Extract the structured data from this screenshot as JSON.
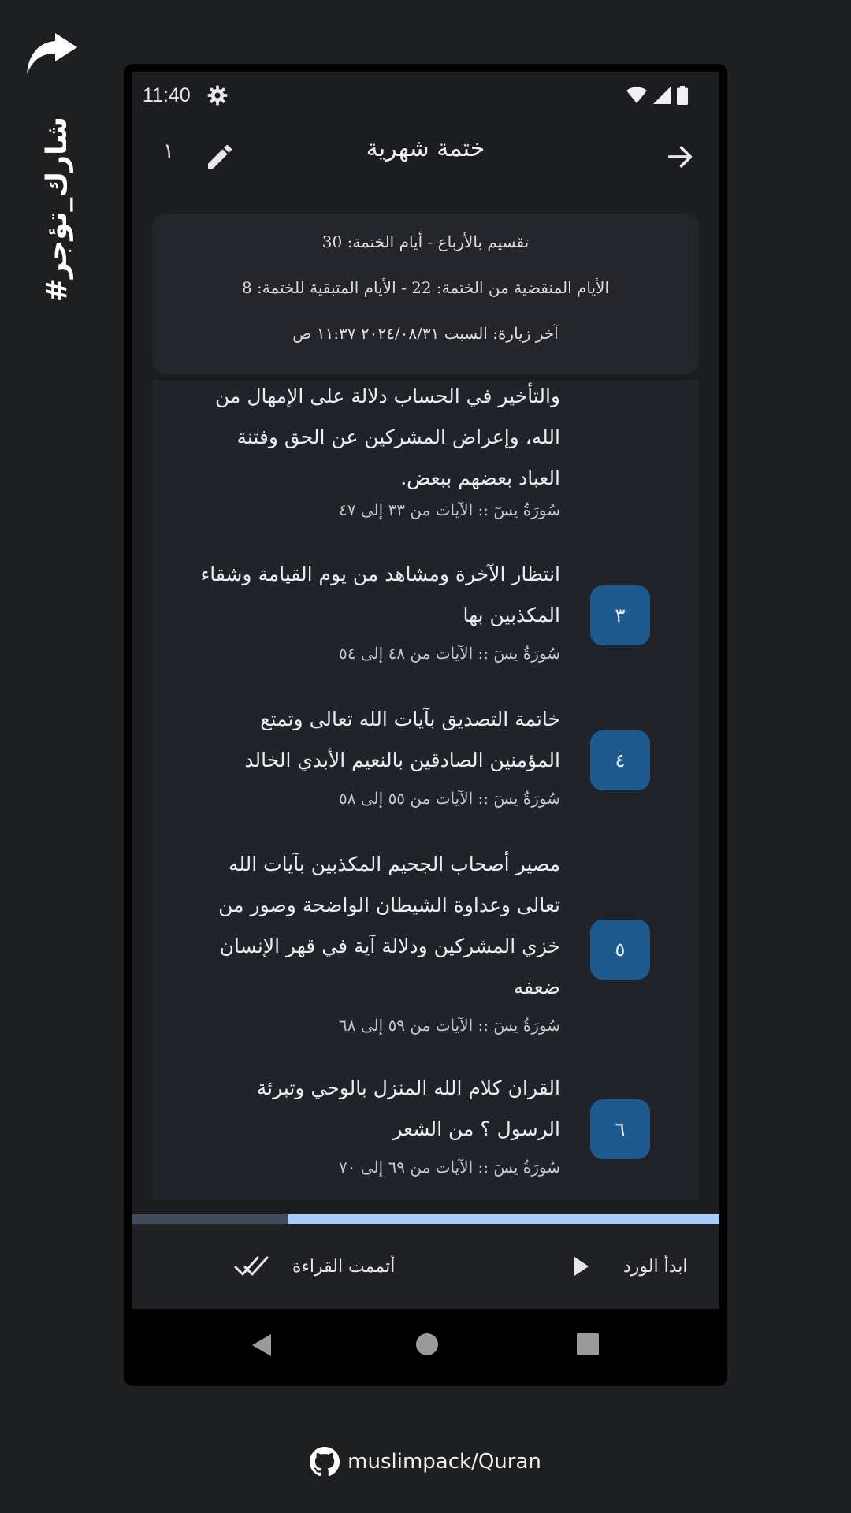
{
  "share": {
    "hashtag": "#شارك_تؤجر",
    "icon": "share-arrow-icon"
  },
  "status_bar": {
    "time": "11:40"
  },
  "app_bar": {
    "title": "ختمة شهرية",
    "counter": "١"
  },
  "info": {
    "line1": "تقسيم بالأرباع - أيام الختمة: 30",
    "line2": "الأيام المنقضية من الختمة: 22 - الأيام المتبقية للختمة: 8",
    "line3": "آخر زيارة: السبت ٢٠٢٤/٠٨/٣١  ١١:٣٧ ص"
  },
  "items": [
    {
      "number": "",
      "text": "والتأخير في الحساب دلالة على الإمهال من الله، وإعراض المشركين عن الحق وفتنة العباد بعضهم ببعض.",
      "range": "سُورَةُ يسٓ :: الآيات من ٣٣ إلى ٤٧"
    },
    {
      "number": "٣",
      "text": "انتظار الآخرة ومشاهد من يوم القيامة وشقاء المكذبين بها",
      "range": "سُورَةُ يسٓ :: الآيات من ٤٨ إلى ٥٤"
    },
    {
      "number": "٤",
      "text": "خاتمة التصديق بآيات الله تعالى وتمتع المؤمنين الصادقين بالنعيم الأبدي الخالد",
      "range": "سُورَةُ يسٓ :: الآيات من ٥٥ إلى ٥٨"
    },
    {
      "number": "٥",
      "text": "مصير أصحاب الجحيم المكذبين بآيات الله تعالى وعداوة الشيطان الواضحة وصور من خزي المشركين ودلالة آية في قهر الإنسان ضعفه",
      "range": "سُورَةُ يسٓ :: الآيات من ٥٩ إلى ٦٨"
    },
    {
      "number": "٦",
      "text": "القران كلام الله المنزل بالوحي وتبرئة الرسول ؟ من الشعر",
      "range": "سُورَةُ يسٓ :: الآيات من ٦٩ إلى ٧٠"
    }
  ],
  "progress": {
    "fraction": 0.267
  },
  "actions": {
    "start_label": "ابدأ الورد",
    "done_label": "أتممت القراءة"
  },
  "footer": {
    "text": "muslimpack/Quran"
  },
  "colors": {
    "badge": "#1f5a8e",
    "progress": "#a8ccff",
    "background": "#1b1d21"
  }
}
